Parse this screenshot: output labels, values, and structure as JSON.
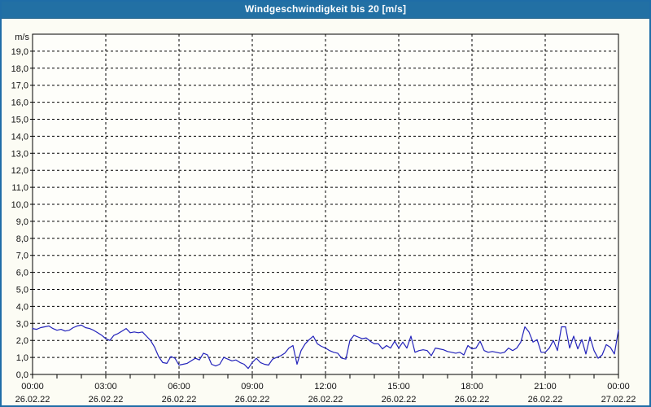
{
  "window": {
    "title": "Windgeschwindigkeit bis 20 [m/s]"
  },
  "colors": {
    "titlebar_bg": "#2270a4",
    "titlebar_text": "#ffffff",
    "window_border": "#1f6da7",
    "page_bg": "#fcfcf4",
    "plot_bg": "#fefefa",
    "grid": "#000000",
    "axis": "#000000",
    "line": "#2222bb",
    "label": "#111111"
  },
  "chart_data": {
    "type": "line",
    "title": "Windgeschwindigkeit bis 20 [m/s]",
    "unit_label": "m/s",
    "ylim": [
      0,
      20
    ],
    "ytick_step": 1,
    "ytick_labels": [
      "0,0",
      "1,0",
      "2,0",
      "3,0",
      "4,0",
      "5,0",
      "6,0",
      "7,0",
      "8,0",
      "9,0",
      "10,0",
      "11,0",
      "12,0",
      "13,0",
      "14,0",
      "15,0",
      "16,0",
      "17,0",
      "18,0",
      "19,0"
    ],
    "grid": "dashed",
    "legend": "none",
    "x_total_minutes": 1440,
    "x_step_minutes": 10,
    "x_minor_tick_minutes": 60,
    "x_major_tick_minutes": 180,
    "xticks": [
      {
        "time": "00:00",
        "date": "26.02.22"
      },
      {
        "time": "03:00",
        "date": "26.02.22"
      },
      {
        "time": "06:00",
        "date": "26.02.22"
      },
      {
        "time": "09:00",
        "date": "26.02.22"
      },
      {
        "time": "12:00",
        "date": "26.02.22"
      },
      {
        "time": "15:00",
        "date": "26.02.22"
      },
      {
        "time": "18:00",
        "date": "26.02.22"
      },
      {
        "time": "21:00",
        "date": "26.02.22"
      },
      {
        "time": "00:00",
        "date": "27.02.22"
      }
    ],
    "series": [
      {
        "name": "Windgeschwindigkeit",
        "color": "#2222bb",
        "values": [
          2.7,
          2.65,
          2.75,
          2.8,
          2.85,
          2.7,
          2.6,
          2.65,
          2.55,
          2.6,
          2.75,
          2.85,
          2.9,
          2.75,
          2.7,
          2.6,
          2.45,
          2.3,
          2.1,
          2.0,
          2.3,
          2.4,
          2.55,
          2.7,
          2.45,
          2.5,
          2.45,
          2.5,
          2.25,
          2.0,
          1.6,
          1.05,
          0.7,
          0.65,
          1.05,
          0.95,
          0.55,
          0.6,
          0.65,
          0.8,
          0.95,
          0.85,
          1.25,
          1.15,
          0.6,
          0.5,
          0.6,
          1.0,
          0.9,
          0.8,
          0.85,
          0.7,
          0.6,
          0.35,
          0.7,
          0.95,
          0.7,
          0.6,
          0.55,
          0.9,
          1.0,
          1.1,
          1.25,
          1.55,
          1.7,
          0.6,
          1.4,
          1.8,
          2.05,
          2.25,
          1.8,
          1.65,
          1.55,
          1.4,
          1.3,
          1.25,
          0.95,
          0.9,
          2.0,
          2.3,
          2.2,
          2.1,
          2.15,
          1.95,
          1.8,
          1.8,
          1.5,
          1.7,
          1.55,
          1.95,
          1.55,
          1.9,
          1.55,
          2.25,
          1.3,
          1.4,
          1.45,
          1.4,
          1.1,
          1.55,
          1.5,
          1.45,
          1.35,
          1.3,
          1.25,
          1.3,
          1.15,
          1.7,
          1.5,
          1.55,
          1.95,
          1.4,
          1.3,
          1.35,
          1.3,
          1.25,
          1.3,
          1.55,
          1.4,
          1.55,
          1.9,
          2.8,
          2.5,
          1.9,
          2.05,
          1.3,
          1.3,
          1.55,
          2.0,
          1.4,
          2.8,
          2.8,
          1.55,
          2.25,
          1.5,
          2.05,
          1.2,
          2.2,
          1.4,
          0.95,
          1.15,
          1.75,
          1.6,
          1.2,
          2.6
        ]
      }
    ]
  }
}
